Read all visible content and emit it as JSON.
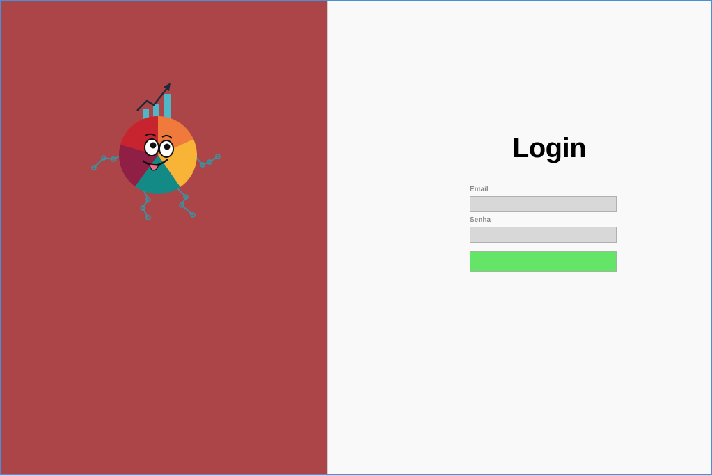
{
  "login": {
    "title": "Login",
    "email_label": "Email",
    "email_value": "",
    "password_label": "Senha",
    "password_value": "",
    "submit_label": ""
  },
  "colors": {
    "left_panel": "#ac4547",
    "right_panel": "#f9f9f9",
    "submit_button": "#65e568",
    "input_background": "#d8d8d8"
  },
  "illustration": {
    "icon": "pie-chart-mascot-icon"
  }
}
